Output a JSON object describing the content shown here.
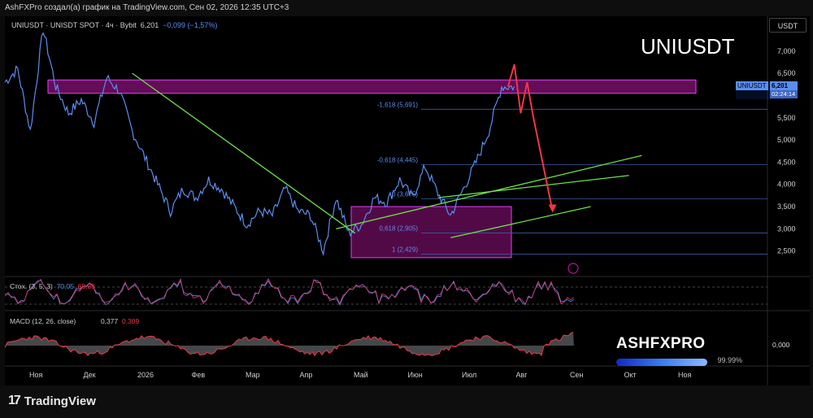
{
  "header": {
    "attribution": "AshFXPro создал(а) график на TradingView.com, Сен 02, 2026 12:35 UTC+3"
  },
  "legend": {
    "symbol": "UNIUSDT · UNISDT SPOT · 4ч · Bybit",
    "price": "6,201",
    "change": "−0,099 (−1,57%)"
  },
  "overlay_title": "UNIUSDT",
  "currency_button": "USDT",
  "price_tag": {
    "symbol": "UNIUSDT",
    "price": "6,201",
    "countdown": "02:24:14"
  },
  "stoch": {
    "label": "Стох. (3, 5, 3)",
    "k": "70,05",
    "d": "68,86"
  },
  "macd": {
    "label": "MACD (12, 26, close)",
    "macd": "0,377",
    "signal": "0,309",
    "axis_label": "0,000"
  },
  "brand": {
    "name": "ASHFXPRO",
    "percent": "99.99%"
  },
  "footer": {
    "logo_text": "TradingView",
    "logo_mark": "17"
  },
  "chart_data": {
    "type": "line",
    "title": "UNIUSDT",
    "ylim": [
      2.0,
      7.6
    ],
    "y_ticks": [
      "7,000",
      "6,500",
      "6,000",
      "5,500",
      "5,000",
      "4,500",
      "4,000",
      "3,500",
      "3,000",
      "2,500"
    ],
    "y_tick_values": [
      7.0,
      6.5,
      6.0,
      5.5,
      5.0,
      4.5,
      4.0,
      3.5,
      3.0,
      2.5
    ],
    "x_ticks": [
      "Ноя",
      "Дек",
      "2026",
      "Фев",
      "Мар",
      "Апр",
      "Май",
      "Июн",
      "Июл",
      "Авг",
      "Сен",
      "Окт",
      "Ноя"
    ],
    "series": [
      {
        "color": "#5b8def",
        "x": [
          0,
          2,
          4,
          6,
          8,
          10,
          12,
          14,
          16,
          18,
          20,
          22,
          24,
          26,
          28,
          30,
          32,
          34,
          36,
          38,
          40,
          42,
          44,
          46,
          48,
          50,
          52,
          54,
          56,
          58,
          60,
          62,
          64,
          66,
          68,
          70,
          72,
          74,
          76,
          78,
          80,
          82,
          84,
          86,
          88,
          90,
          92,
          94,
          96,
          98,
          100
        ],
        "y": [
          6.3,
          6.6,
          5.2,
          7.5,
          6.2,
          5.6,
          5.9,
          5.4,
          6.4,
          6.1,
          5.2,
          4.6,
          4.0,
          3.4,
          3.9,
          3.7,
          4.1,
          3.9,
          3.5,
          3.1,
          3.4,
          3.3,
          3.9,
          3.4,
          3.3,
          2.5,
          3.7,
          2.9,
          3.1,
          3.7,
          3.6,
          4.1,
          3.7,
          4.4,
          3.8,
          3.3,
          3.9,
          4.5,
          5.2,
          6.2,
          6.2,
          6.2,
          6.2,
          6.2,
          6.2,
          6.2,
          6.2,
          6.2,
          6.2,
          6.2,
          6.2
        ]
      }
    ],
    "forecast": {
      "color": "#f23645",
      "x": [
        79,
        80,
        81,
        82,
        83,
        84,
        86
      ],
      "y": [
        6.2,
        6.7,
        5.6,
        6.3,
        5.5,
        4.8,
        3.4
      ]
    },
    "resistance_zone": [
      6.05,
      6.35
    ],
    "support_zone": [
      2.35,
      3.5
    ],
    "fib_levels": [
      {
        "label": "-1,618 (5,691)",
        "value": 5.691
      },
      {
        "label": "-0,618 (4,445)",
        "value": 4.445
      },
      {
        "label": "0 (3,675)",
        "value": 3.675
      },
      {
        "label": "0,618 (2,905)",
        "value": 2.905
      },
      {
        "label": "1 (2,429)",
        "value": 2.429
      }
    ],
    "trendlines": [
      {
        "color": "#6ee04a",
        "from": [
          20,
          6.5
        ],
        "to": [
          55,
          2.9
        ]
      },
      {
        "color": "#6ee04a",
        "from": [
          52,
          3.0
        ],
        "to": [
          100,
          4.65
        ]
      },
      {
        "color": "#6ee04a",
        "from": [
          68,
          3.7
        ],
        "to": [
          98,
          4.2
        ]
      },
      {
        "color": "#6ee04a",
        "from": [
          70,
          2.8
        ],
        "to": [
          92,
          3.5
        ]
      }
    ]
  }
}
